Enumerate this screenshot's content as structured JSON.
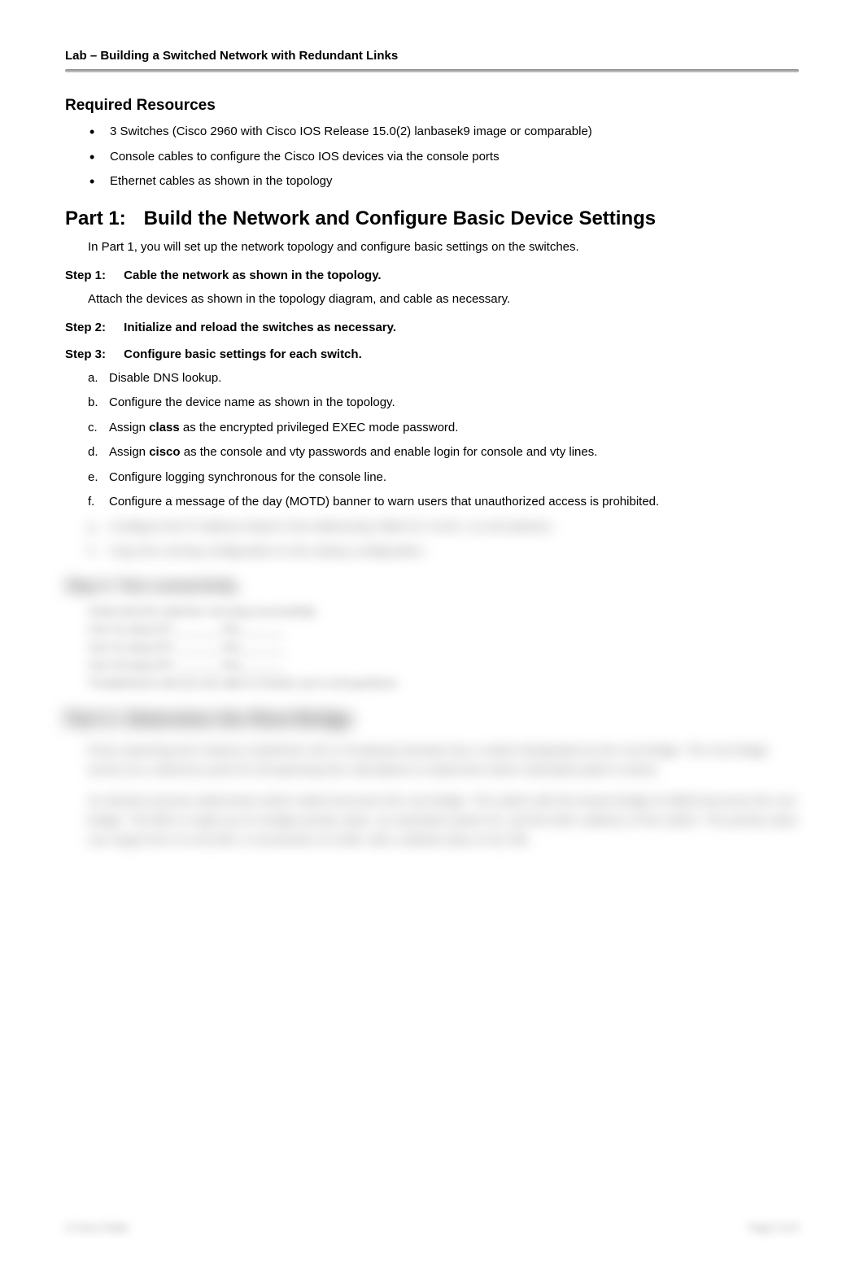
{
  "header": {
    "title": "Lab – Building a Switched Network with Redundant Links"
  },
  "required_resources": {
    "title": "Required Resources",
    "items": [
      "3 Switches (Cisco 2960 with Cisco IOS Release 15.0(2) lanbasek9 image or comparable)",
      "Console cables to configure the Cisco IOS devices via the console ports",
      "Ethernet cables as shown in the topology"
    ]
  },
  "part1": {
    "label": "Part 1:",
    "title": "Build the Network and Configure Basic Device Settings",
    "intro": "In Part 1, you will set up the network topology and configure basic settings on the switches."
  },
  "step1": {
    "label": "Step 1:",
    "title": "Cable the network as shown in the topology.",
    "text": "Attach the devices as shown in the topology diagram, and cable as necessary."
  },
  "step2": {
    "label": "Step 2:",
    "title": "Initialize and reload the switches as necessary."
  },
  "step3": {
    "label": "Step 3:",
    "title": "Configure basic settings for each switch.",
    "items": [
      {
        "letter": "a.",
        "text_before": "Disable DNS lookup.",
        "bold": "",
        "text_after": ""
      },
      {
        "letter": "b.",
        "text_before": "Configure the device name as shown in the topology.",
        "bold": "",
        "text_after": ""
      },
      {
        "letter": "c.",
        "text_before": "Assign ",
        "bold": "class",
        "text_after": " as the encrypted privileged EXEC mode password."
      },
      {
        "letter": "d.",
        "text_before": "Assign ",
        "bold": "cisco",
        "text_after": " as the console and vty passwords and enable login for console and vty lines."
      },
      {
        "letter": "e.",
        "text_before": "Configure logging synchronous for the console line.",
        "bold": "",
        "text_after": ""
      },
      {
        "letter": "f.",
        "text_before": "Configure a message of the day (MOTD) banner to warn users that unauthorized access is prohibited.",
        "bold": "",
        "text_after": ""
      }
    ]
  },
  "blurred": {
    "step3_extra": [
      {
        "letter": "g.",
        "text": "Configure the IP address listed in the Addressing Table for VLAN 1 on all switches."
      },
      {
        "letter": "h.",
        "text": "Copy the running configuration to the startup configuration."
      }
    ],
    "step4_title": "Step 4:   Test connectivity.",
    "step4_text": "Verify that the switches can ping successfully.",
    "pings": [
      "Can S1 ping S2?  _______Yes_______",
      "Can S1 ping S3?  _______Yes_______",
      "Can S2 ping S3?  _______Yes_______"
    ],
    "step4_troubleshoot": "Troubleshoot until you are able to answer yes to all questions.",
    "part2_title": "Part 2:   Determine the Root Bridge",
    "part2_para1": "Every spanning-tree instance (switched LAN or broadcast domain) has a switch designated as the root bridge. The root bridge serves as a reference point for all spanning-tree calculations to determine which redundant paths to block.",
    "part2_para2": "An election process determines which switch becomes the root bridge. The switch with the lowest bridge ID (BID) becomes the root bridge. The BID is made up of a bridge priority value, an extended system ID, and the MAC address of the switch. The priority value can range from 0 to 65,535, in increments of 4,096, with a default value of 32,768."
  },
  "footer": {
    "left": "© Cisco Public",
    "right": "Page 2 of 6"
  }
}
